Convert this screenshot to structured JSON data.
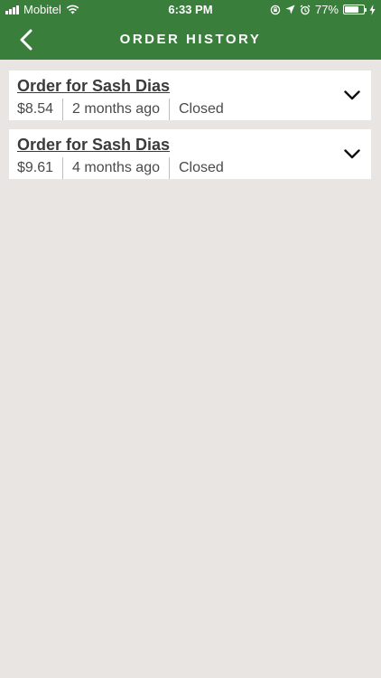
{
  "status_bar": {
    "carrier": "Mobitel",
    "time": "6:33 PM",
    "battery_percent": "77%",
    "battery_level": 0.77
  },
  "nav": {
    "title": "ORDER HISTORY"
  },
  "orders": [
    {
      "title": "Order for Sash Dias",
      "price": "$8.54",
      "age": "2 months ago",
      "status": "Closed"
    },
    {
      "title": "Order for Sash Dias",
      "price": "$9.61",
      "age": "4 months ago",
      "status": "Closed"
    }
  ],
  "colors": {
    "header": "#3a7e3c",
    "background": "#e9e5e3",
    "card": "#ffffff",
    "text": "#3b3b3b"
  }
}
